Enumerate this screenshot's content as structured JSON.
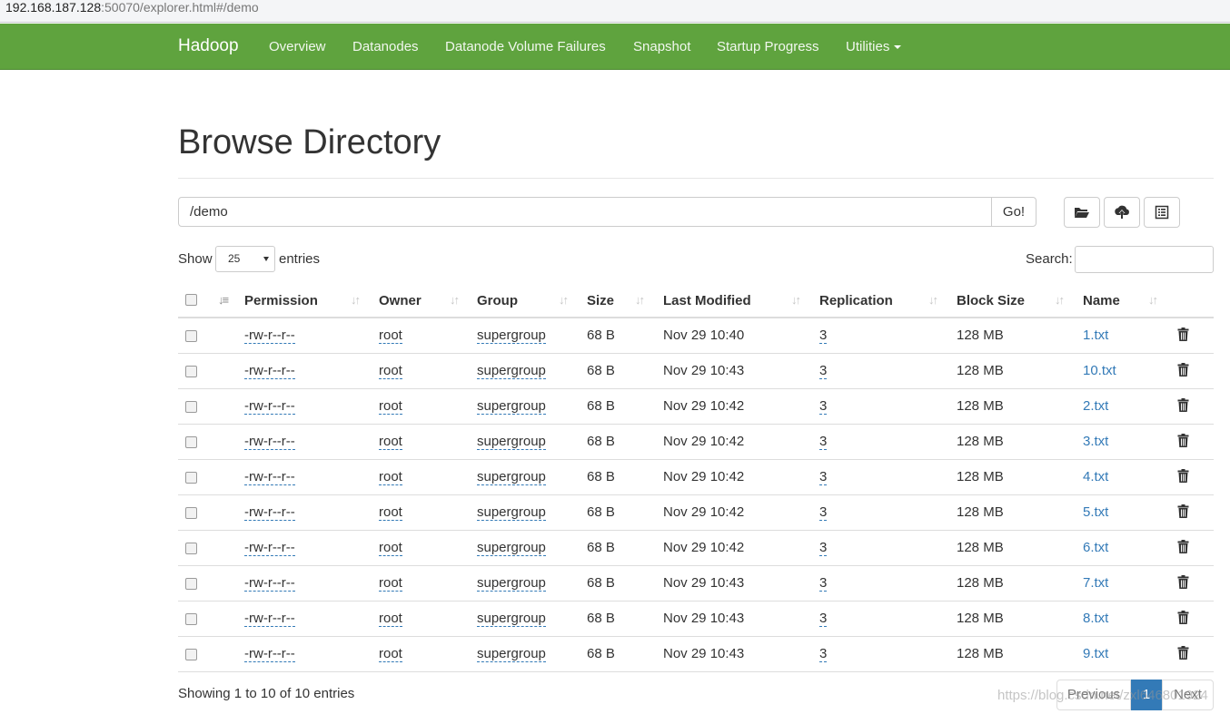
{
  "browser": {
    "url_host": "192.168.187.128",
    "url_rest": ":50070/explorer.html#/demo"
  },
  "navbar": {
    "brand": "Hadoop",
    "items": [
      {
        "label": "Overview"
      },
      {
        "label": "Datanodes"
      },
      {
        "label": "Datanode Volume Failures"
      },
      {
        "label": "Snapshot"
      },
      {
        "label": "Startup Progress"
      },
      {
        "label": "Utilities"
      }
    ]
  },
  "page": {
    "title": "Browse Directory"
  },
  "pathbar": {
    "value": "/demo",
    "go_label": "Go!"
  },
  "toolbar": {
    "icons": [
      "folder-open-icon",
      "upload-icon",
      "list-icon"
    ]
  },
  "table_controls": {
    "show_label": "Show",
    "entries_value": "25",
    "entries_label": "entries",
    "search_label": "Search:"
  },
  "table": {
    "columns": [
      "Permission",
      "Owner",
      "Group",
      "Size",
      "Last Modified",
      "Replication",
      "Block Size",
      "Name"
    ],
    "rows": [
      {
        "permission": "-rw-r--r--",
        "owner": "root",
        "group": "supergroup",
        "size": "68 B",
        "modified": "Nov 29 10:40",
        "replication": "3",
        "block_size": "128 MB",
        "name": "1.txt"
      },
      {
        "permission": "-rw-r--r--",
        "owner": "root",
        "group": "supergroup",
        "size": "68 B",
        "modified": "Nov 29 10:43",
        "replication": "3",
        "block_size": "128 MB",
        "name": "10.txt"
      },
      {
        "permission": "-rw-r--r--",
        "owner": "root",
        "group": "supergroup",
        "size": "68 B",
        "modified": "Nov 29 10:42",
        "replication": "3",
        "block_size": "128 MB",
        "name": "2.txt"
      },
      {
        "permission": "-rw-r--r--",
        "owner": "root",
        "group": "supergroup",
        "size": "68 B",
        "modified": "Nov 29 10:42",
        "replication": "3",
        "block_size": "128 MB",
        "name": "3.txt"
      },
      {
        "permission": "-rw-r--r--",
        "owner": "root",
        "group": "supergroup",
        "size": "68 B",
        "modified": "Nov 29 10:42",
        "replication": "3",
        "block_size": "128 MB",
        "name": "4.txt"
      },
      {
        "permission": "-rw-r--r--",
        "owner": "root",
        "group": "supergroup",
        "size": "68 B",
        "modified": "Nov 29 10:42",
        "replication": "3",
        "block_size": "128 MB",
        "name": "5.txt"
      },
      {
        "permission": "-rw-r--r--",
        "owner": "root",
        "group": "supergroup",
        "size": "68 B",
        "modified": "Nov 29 10:42",
        "replication": "3",
        "block_size": "128 MB",
        "name": "6.txt"
      },
      {
        "permission": "-rw-r--r--",
        "owner": "root",
        "group": "supergroup",
        "size": "68 B",
        "modified": "Nov 29 10:43",
        "replication": "3",
        "block_size": "128 MB",
        "name": "7.txt"
      },
      {
        "permission": "-rw-r--r--",
        "owner": "root",
        "group": "supergroup",
        "size": "68 B",
        "modified": "Nov 29 10:43",
        "replication": "3",
        "block_size": "128 MB",
        "name": "8.txt"
      },
      {
        "permission": "-rw-r--r--",
        "owner": "root",
        "group": "supergroup",
        "size": "68 B",
        "modified": "Nov 29 10:43",
        "replication": "3",
        "block_size": "128 MB",
        "name": "9.txt"
      }
    ]
  },
  "footer": {
    "info": "Showing 1 to 10 of 10 entries",
    "previous": "Previous",
    "page": "1",
    "next": "Next"
  },
  "watermark": "https://blog.csdn.net/zxl646801924",
  "colors": {
    "navbar": "#5fa33e",
    "link": "#337ab7",
    "active_page": "#337ab7"
  }
}
